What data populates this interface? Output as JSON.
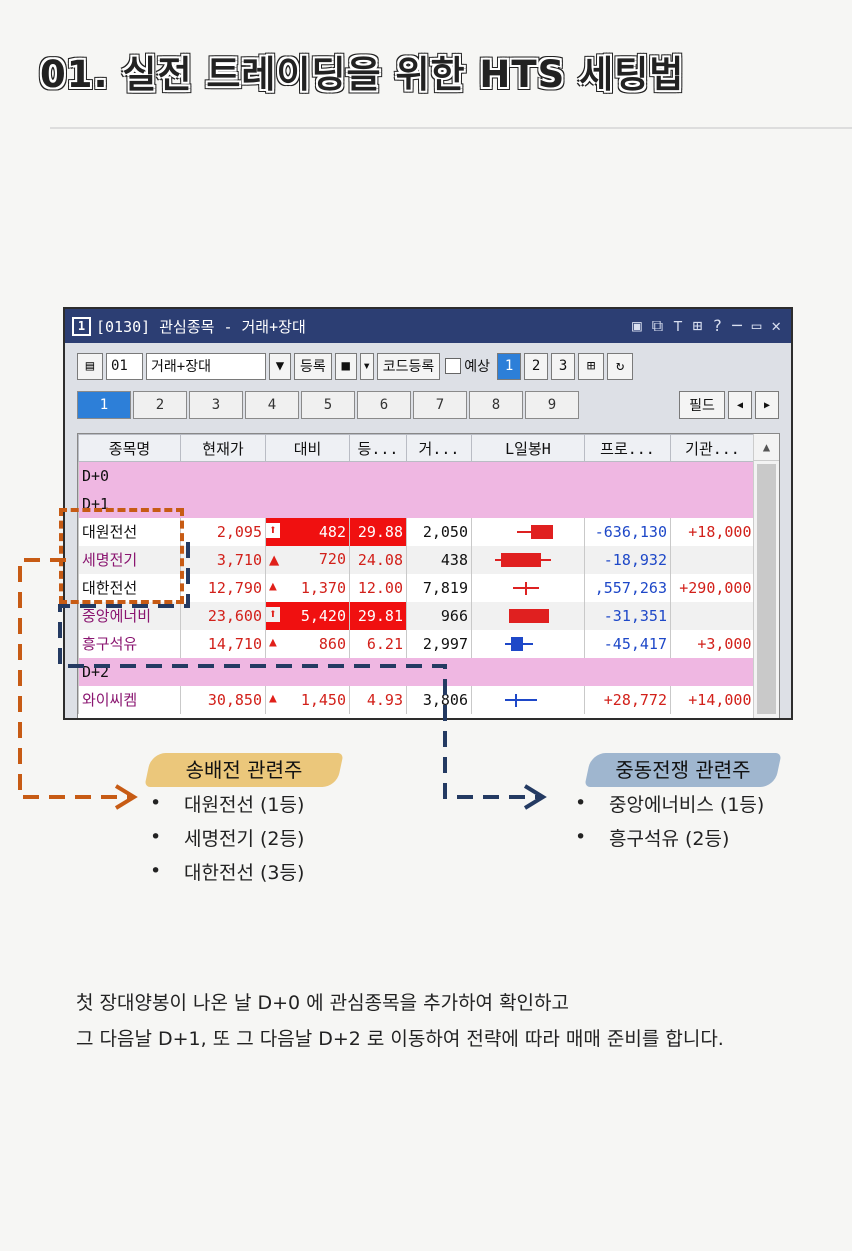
{
  "page": {
    "title": "01. 실전 트레이딩을 위한 HTS 세팅법"
  },
  "window": {
    "number": "1",
    "title": "[0130] 관심종목 - 거래+장대",
    "controls": [
      "▣",
      "⧉",
      "📌",
      "⊞",
      "?",
      "─",
      "▭",
      "✕"
    ]
  },
  "toolbar": {
    "group_code": "01",
    "group_name": "거래+장대",
    "register_label": "등록",
    "code_register_label": "코드등록",
    "predict_label": "예상",
    "view_buttons": [
      "1",
      "2",
      "3"
    ]
  },
  "tabs": [
    "1",
    "2",
    "3",
    "4",
    "5",
    "6",
    "7",
    "8",
    "9"
  ],
  "tabs_right": {
    "field_label": "필드",
    "prev": "◀",
    "next": "▶"
  },
  "columns": [
    "종목명",
    "현재가",
    "대비",
    "등...",
    "거...",
    "L일봉H",
    "프로...",
    "기관..."
  ],
  "sections": {
    "d0": "D+0",
    "d1": "D+1",
    "d2": "D+2"
  },
  "rows_d1": [
    {
      "name": "대원전선",
      "price": "2,095",
      "arrow": "⬆",
      "change": "482",
      "rate": "29.88",
      "volume": "2,050",
      "program": "-636,130",
      "inst": "+18,000"
    },
    {
      "name": "세명전기",
      "price": "3,710",
      "arrow": "▲",
      "change": "720",
      "rate": "24.08",
      "volume": "438",
      "program": "-18,932",
      "inst": ""
    },
    {
      "name": "대한전선",
      "price": "12,790",
      "arrow": "▲",
      "change": "1,370",
      "rate": "12.00",
      "volume": "7,819",
      "program": ",557,263",
      "inst": "+290,000"
    },
    {
      "name": "중앙에너비",
      "price": "23,600",
      "arrow": "⬆",
      "change": "5,420",
      "rate": "29.81",
      "volume": "966",
      "program": "-31,351",
      "inst": ""
    },
    {
      "name": "흥구석유",
      "price": "14,710",
      "arrow": "▲",
      "change": "860",
      "rate": "6.21",
      "volume": "2,997",
      "program": "-45,417",
      "inst": "+3,000"
    }
  ],
  "rows_d2": [
    {
      "name": "와이씨켐",
      "price": "30,850",
      "arrow": "▲",
      "change": "1,450",
      "rate": "4.93",
      "volume": "3,806",
      "program": "+28,772",
      "inst": "+14,000"
    }
  ],
  "group_a": {
    "label": "송배전 관련주",
    "items": [
      "대원전선 (1등)",
      "세명전기 (2등)",
      "대한전선 (3등)"
    ]
  },
  "group_b": {
    "label": "중동전쟁 관련주",
    "items": [
      "중앙에너비스 (1등)",
      "흥구석유 (2등)"
    ]
  },
  "bullet_char": "•",
  "description": {
    "line1": "첫 장대양봉이 나온 날 D+0 에 관심종목을 추가하여 확인하고",
    "line2": "그 다음날 D+1,  또 그 다음날 D+2 로 이동하여 전략에 따라 매매 준비를 합니다."
  },
  "colors": {
    "orange_dash": "#c75b14",
    "navy_dash": "#243a62",
    "label_a_bg": "#ebc77b",
    "label_b_bg": "#9fb6cf",
    "section_bg": "#efb7e2",
    "title_bar": "#2c3e73"
  }
}
